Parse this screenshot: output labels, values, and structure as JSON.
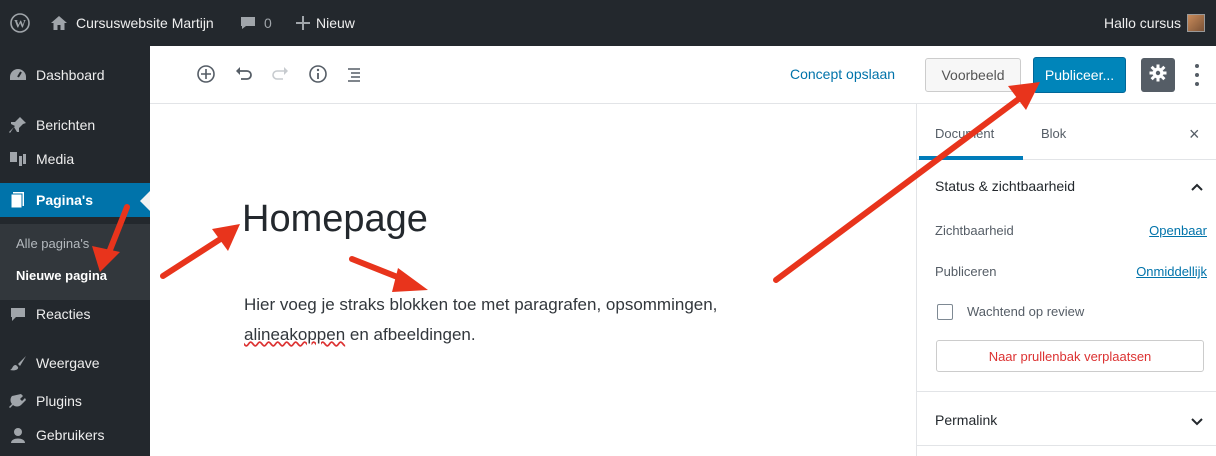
{
  "adminbar": {
    "site_name": "Cursuswebsite Martijn",
    "comments_count": "0",
    "new_label": "Nieuw",
    "greeting": "Hallo cursus"
  },
  "sidebar": {
    "items": [
      {
        "label": "Dashboard",
        "icon": "dashboard-icon"
      },
      {
        "label": "Berichten",
        "icon": "pin-icon"
      },
      {
        "label": "Media",
        "icon": "media-icon"
      },
      {
        "label": "Pagina's",
        "icon": "pages-icon",
        "active": true
      },
      {
        "label": "Reacties",
        "icon": "comment-icon"
      },
      {
        "label": "Weergave",
        "icon": "brush-icon"
      },
      {
        "label": "Plugins",
        "icon": "plugin-icon"
      },
      {
        "label": "Gebruikers",
        "icon": "users-icon"
      }
    ],
    "submenu": [
      {
        "label": "Alle pagina's"
      },
      {
        "label": "Nieuwe pagina",
        "current": true
      }
    ]
  },
  "toolbar": {
    "concept_label": "Concept opslaan",
    "voorbeeld_label": "Voorbeeld",
    "publish_label": "Publiceer..."
  },
  "editor": {
    "title": "Homepage",
    "paragraph_part1": "Hier voeg je straks blokken toe met paragrafen, opsommingen,",
    "paragraph_misspelled": "alineakoppen",
    "paragraph_part2": " en afbeeldingen."
  },
  "panel": {
    "tab_document": "Document",
    "tab_blok": "Blok",
    "close": "×",
    "status_heading": "Status & zichtbaarheid",
    "visibility_label": "Zichtbaarheid",
    "visibility_value": "Openbaar",
    "publish_label": "Publiceren",
    "publish_value": "Onmiddellijk",
    "review_label": "Wachtend op review",
    "trash_label": "Naar prullenbak verplaatsen",
    "permalink_heading": "Permalink"
  },
  "colors": {
    "admin_dark": "#23282d",
    "accent_blue": "#0073aa",
    "publish_blue": "#0085ba",
    "arrow_red": "#e8341c"
  }
}
